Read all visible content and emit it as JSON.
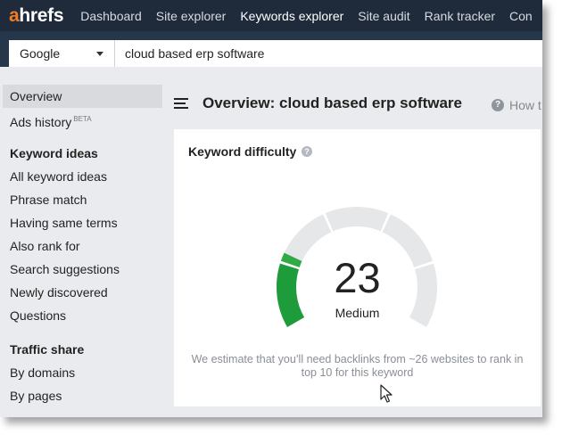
{
  "app": {
    "logo": {
      "accent_letter": "a",
      "rest": "hrefs"
    },
    "nav": [
      "Dashboard",
      "Site explorer",
      "Keywords explorer",
      "Site audit",
      "Rank tracker",
      "Con"
    ],
    "active_nav": "Keywords explorer"
  },
  "search": {
    "engine": "Google",
    "query": "cloud based erp software"
  },
  "sidebar": {
    "overview": "Overview",
    "ads_history": "Ads history",
    "ads_badge": "BETA",
    "keyword_ideas_heading": "Keyword ideas",
    "keyword_ideas": [
      "All keyword ideas",
      "Phrase match",
      "Having same terms",
      "Also rank for",
      "Search suggestions",
      "Newly discovered",
      "Questions"
    ],
    "traffic_heading": "Traffic share",
    "traffic": [
      "By domains",
      "By pages"
    ]
  },
  "header": {
    "title": "Overview: cloud based erp software",
    "help_label": "How t"
  },
  "keyword_difficulty": {
    "title": "Keyword difficulty",
    "help_glyph": "?",
    "value": "23",
    "score": 23,
    "level": "Medium",
    "note": "We estimate that you’ll need backlinks from ~26 websites to rank in top 10 for this keyword"
  },
  "colors": {
    "nav_bg": "#1f2b3a",
    "accent": "#f47b20",
    "gauge_fill": "#2faa45",
    "gauge_track": "#e6e7e8"
  }
}
